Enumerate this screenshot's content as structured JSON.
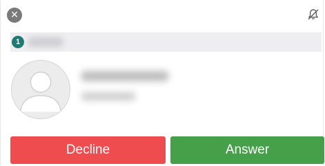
{
  "header": {
    "close_icon": "close-icon",
    "close_glyph": "✕",
    "mute_icon": "bell-off-icon"
  },
  "queue": {
    "count": "1",
    "badge_color": "#1f7a73"
  },
  "caller": {
    "avatar_icon": "default-avatar-icon"
  },
  "actions": {
    "decline_label": "Decline",
    "answer_label": "Answer",
    "decline_color": "#ee4c4f",
    "answer_color": "#45a049"
  }
}
